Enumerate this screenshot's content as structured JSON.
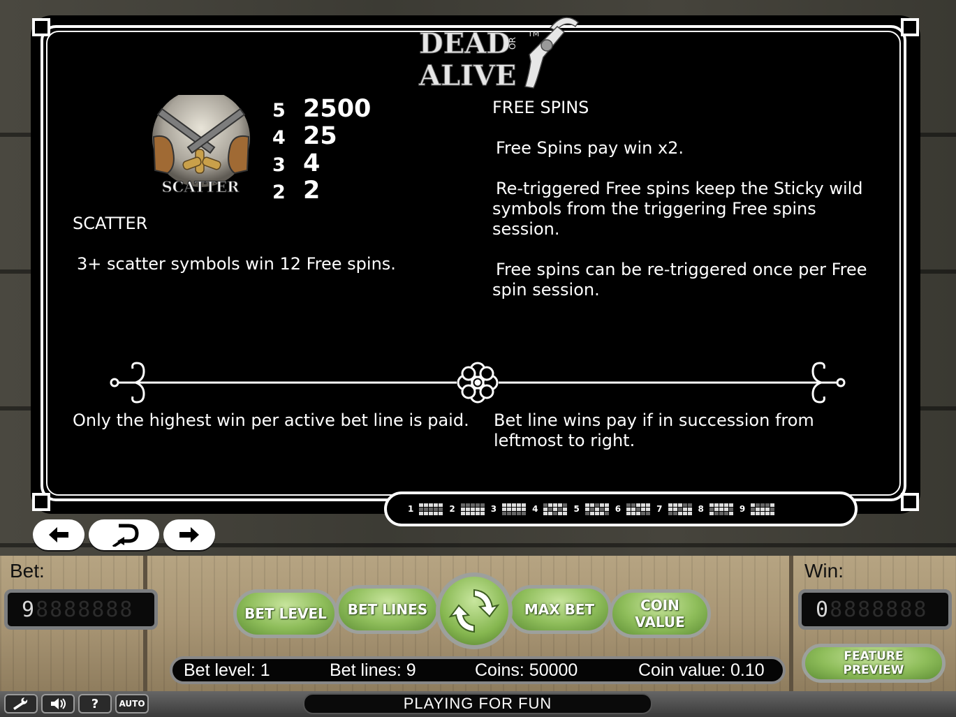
{
  "game": {
    "logo_text_top": "DEAD",
    "logo_text_or": "OR",
    "logo_text_bottom": "ALIVE",
    "logo_tm": "TM"
  },
  "scatter": {
    "symbol_label": "SCATTER",
    "pays": [
      {
        "count": "5",
        "value": "2500"
      },
      {
        "count": "4",
        "value": "25"
      },
      {
        "count": "3",
        "value": "4"
      },
      {
        "count": "2",
        "value": "2"
      }
    ],
    "heading": "SCATTER",
    "description": "3+ scatter symbols win 12 Free spins."
  },
  "free_spins": {
    "heading": "FREE SPINS",
    "rule_1": "Free Spins pay win x2.",
    "rule_2": "Re-triggered Free spins keep the Sticky wild symbols from the triggering Free spins session.",
    "rule_3": "Free spins can be re-triggered once per Free spin session."
  },
  "rules": {
    "left": "Only the highest win per active bet line is paid.",
    "right": "Bet line wins pay if in succession from leftmost to right."
  },
  "bet_lines": [
    {
      "number": "1",
      "pattern": [
        0,
        0,
        0,
        0,
        0,
        1,
        1,
        1,
        1,
        1,
        0,
        0,
        0,
        0,
        0
      ]
    },
    {
      "number": "2",
      "pattern": [
        1,
        1,
        1,
        1,
        1,
        0,
        0,
        0,
        0,
        0,
        0,
        0,
        0,
        0,
        0
      ]
    },
    {
      "number": "3",
      "pattern": [
        0,
        0,
        0,
        0,
        0,
        0,
        0,
        0,
        0,
        0,
        1,
        1,
        1,
        1,
        1
      ]
    },
    {
      "number": "4",
      "pattern": [
        1,
        0,
        0,
        0,
        1,
        0,
        1,
        0,
        1,
        0,
        0,
        0,
        1,
        0,
        0
      ]
    },
    {
      "number": "5",
      "pattern": [
        0,
        0,
        1,
        0,
        0,
        0,
        1,
        0,
        1,
        0,
        1,
        0,
        0,
        0,
        1
      ]
    },
    {
      "number": "6",
      "pattern": [
        1,
        1,
        0,
        0,
        0,
        0,
        0,
        1,
        0,
        0,
        0,
        0,
        0,
        1,
        1
      ]
    },
    {
      "number": "7",
      "pattern": [
        0,
        0,
        0,
        1,
        1,
        0,
        0,
        1,
        0,
        0,
        1,
        1,
        0,
        0,
        0
      ]
    },
    {
      "number": "8",
      "pattern": [
        0,
        0,
        0,
        0,
        0,
        1,
        0,
        0,
        0,
        1,
        0,
        1,
        1,
        1,
        0
      ]
    },
    {
      "number": "9",
      "pattern": [
        0,
        1,
        1,
        1,
        0,
        1,
        0,
        0,
        0,
        1,
        0,
        0,
        0,
        0,
        0
      ]
    }
  ],
  "nav": {
    "prev_icon": "arrow-left-icon",
    "back_icon": "return-icon",
    "next_icon": "arrow-right-icon"
  },
  "controls": {
    "bet_label": "Bet:",
    "bet_value": "9",
    "bet_unlit": "8888888",
    "win_label": "Win:",
    "win_value": "0",
    "win_unlit": "8888888",
    "bet_level_button": "BET LEVEL",
    "bet_lines_button": "BET LINES",
    "max_bet_button": "MAX BET",
    "coin_value_button_line1": "COIN",
    "coin_value_button_line2": "VALUE",
    "feature_preview_line1": "FEATURE",
    "feature_preview_line2": "PREVIEW",
    "spin_icon": "spin-arrows-icon"
  },
  "info": {
    "bet_level": "Bet level: 1",
    "bet_lines": "Bet lines: 9",
    "coins": "Coins: 50000",
    "coin_value": "Coin value: 0.10"
  },
  "footer": {
    "settings_icon": "wrench-icon",
    "sound_icon": "speaker-icon",
    "help_icon": "question-icon",
    "help_label": "?",
    "auto_label": "AUTO",
    "status": "PLAYING FOR FUN"
  },
  "colors": {
    "panel_bg": "#000000",
    "panel_border": "#ffffff",
    "button_green": "#8ebd5a",
    "wood": "#a89574"
  }
}
